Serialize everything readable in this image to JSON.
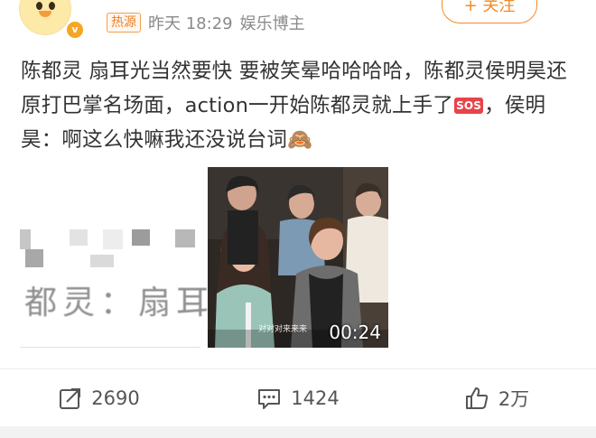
{
  "post": {
    "hot_tag": "热源",
    "time": "昨天 18:29",
    "source": "娱乐博主",
    "follow_label": "+ 关注",
    "text_part1": "陈都灵 扇耳光当然要快 要被笑晕哈哈哈哈，陈都灵侯明昊还原打巴掌名场面，action一开始陈都灵就上手了",
    "sos_label": "SOS",
    "text_part2": "，侯明昊：啊这么快嘛我还没说台词🙈",
    "image_caption": "都灵：扇耳",
    "video_subtitle": "对对对来来来",
    "video_duration": "00:24"
  },
  "actions": {
    "repost_count": "2690",
    "comment_count": "1424",
    "like_count": "2万"
  },
  "icons": {
    "repost": "share-icon",
    "comment": "comment-icon",
    "like": "thumbs-up-icon"
  },
  "colors": {
    "accent": "#f08a2b",
    "hot_tag": "#e8812e"
  }
}
